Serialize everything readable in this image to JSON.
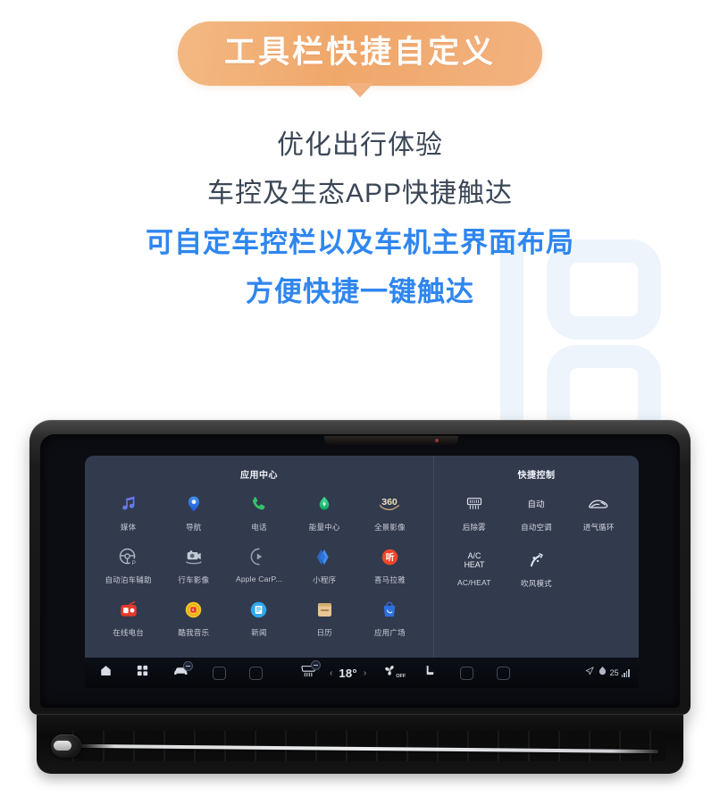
{
  "banner": {
    "text": "工具栏快捷自定义",
    "bg_color": "#f0a76a"
  },
  "copy": {
    "lines": [
      {
        "text": "优化出行体验",
        "style": "plain"
      },
      {
        "text": "车控及生态APP快捷触达",
        "style": "plain"
      },
      {
        "text": "可自定车控栏以及车机主界面布局",
        "style": "accent"
      },
      {
        "text": "方便快捷一键触达",
        "style": "accent"
      }
    ],
    "plain_color": "#3a4656",
    "accent_color": "#2f86ef"
  },
  "infotainment": {
    "app_panel": {
      "title": "应用中心",
      "apps": [
        {
          "label": "媒体",
          "icon": "music-note-icon",
          "color": "#7c6cf0"
        },
        {
          "label": "导航",
          "icon": "map-pin-icon",
          "color": "#2f7dee"
        },
        {
          "label": "电话",
          "icon": "phone-icon",
          "color": "#33c26a"
        },
        {
          "label": "能量中心",
          "icon": "energy-drop-icon",
          "color": "#18c27a"
        },
        {
          "label": "全景影像",
          "icon": "360-camera-icon",
          "color": "#efe0c0"
        },
        {
          "label": "自动泊车辅助",
          "icon": "steering-wheel-park-icon",
          "color": "#aeb6c6"
        },
        {
          "label": "行车影像",
          "icon": "dashcam-icon",
          "color": "#b8bfcc"
        },
        {
          "label": "Apple CarP...",
          "icon": "carplay-play-icon",
          "color": "#9aa2b2"
        },
        {
          "label": "小程序",
          "icon": "mini-program-icon",
          "color": "#3f7ae6"
        },
        {
          "label": "喜马拉雅",
          "icon": "ximalaya-icon",
          "color": "#f2462b"
        },
        {
          "label": "在线电台",
          "icon": "radio-icon",
          "color": "#e8392b"
        },
        {
          "label": "酷我音乐",
          "icon": "kuwo-music-icon",
          "color": "#f5c427"
        },
        {
          "label": "新闻",
          "icon": "news-doc-icon",
          "color": "#2fa8ee"
        },
        {
          "label": "日历",
          "icon": "calendar-icon",
          "color": "#e8c792"
        },
        {
          "label": "应用广场",
          "icon": "app-store-bag-icon",
          "color": "#2f6fe0"
        }
      ]
    },
    "control_panel": {
      "title": "快捷控制",
      "controls": [
        {
          "label": "后除雾",
          "icon": "rear-defog-icon",
          "glyph_text": ""
        },
        {
          "label": "自动空调",
          "icon": "auto-ac-icon",
          "glyph_text": "自动"
        },
        {
          "label": "进气循环",
          "icon": "air-recirculation-icon",
          "glyph_text": ""
        },
        {
          "label": "AC/HEAT",
          "icon": "ac-heat-icon",
          "glyph_text": "A/C HEAT"
        },
        {
          "label": "吹风模式",
          "icon": "blow-mode-icon",
          "glyph_text": ""
        }
      ]
    },
    "dock": {
      "home_icon": "home-icon",
      "apps_icon": "app-grid-icon",
      "vehicle_icon": "vehicle-icon",
      "defrost_icon": "defrost-icon",
      "temp_down": "‹",
      "temperature": "18°",
      "temp_up": "›",
      "fan_icon": "fan-icon",
      "fan_state": "OFF",
      "seat_icon": "seat-heat-icon",
      "nav_icon": "navigation-arrow-icon",
      "eco_icon": "eco-leaf-icon",
      "status_number": "25",
      "signal_icon": "signal-bars-icon"
    }
  }
}
